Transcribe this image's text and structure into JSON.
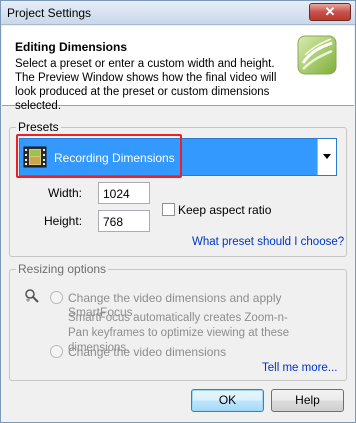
{
  "window": {
    "title": "Project Settings",
    "close_glyph": "✕"
  },
  "header": {
    "title": "Editing Dimensions",
    "description": "Select a preset or enter a custom width and height. The Preview Window shows how the final video will look produced at the preset or custom dimensions selected.",
    "logo_icon": "camtasia-logo-icon"
  },
  "presets": {
    "legend": "Presets",
    "selected": "Recording Dimensions",
    "selected_icon": "film-strip-icon",
    "width_label": "Width:",
    "width_value": "1024",
    "height_label": "Height:",
    "height_value": "768",
    "keep_aspect_label": "Keep aspect ratio",
    "keep_aspect_checked": false,
    "help_link": "What preset should I choose?"
  },
  "resizing": {
    "legend": "Resizing options",
    "option1_label": "Change the video dimensions and apply SmartFocus",
    "option1_desc": "SmartFocus automatically creates Zoom-n-Pan keyframes to optimize viewing at these dimensions.",
    "option2_label": "Change the video dimensions",
    "tell_more_link": "Tell me more..."
  },
  "buttons": {
    "ok": "OK",
    "help": "Help"
  },
  "colors": {
    "selection_blue": "#3399ff",
    "highlight_red": "#e8212b",
    "link_blue": "#0033cc"
  }
}
